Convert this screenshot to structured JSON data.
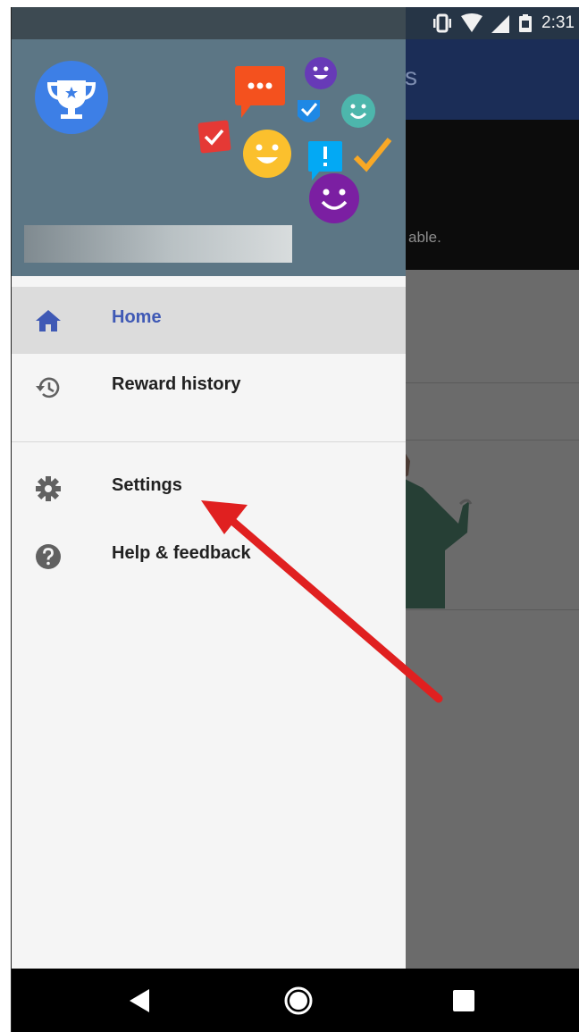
{
  "status_bar": {
    "time": "2:31"
  },
  "background_app": {
    "title": "s",
    "body_text": "able."
  },
  "drawer": {
    "items": [
      {
        "label": "Home"
      },
      {
        "label": "Reward history"
      },
      {
        "label": "Settings"
      },
      {
        "label": "Help & feedback"
      }
    ]
  },
  "colors": {
    "active_accent": "#3f59b5",
    "header_bg": "#5c7685",
    "annotation_arrow": "#e02020"
  }
}
